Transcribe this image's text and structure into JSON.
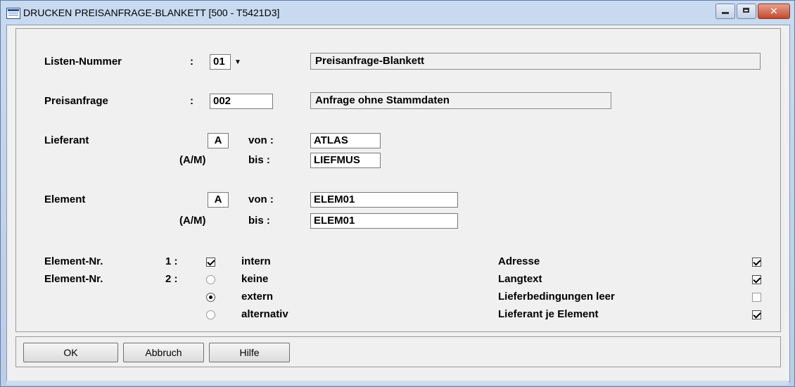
{
  "window": {
    "title": "DRUCKEN PREISANFRAGE-BLANKETT  [500 - T5421D3]"
  },
  "listen": {
    "label": "Listen-Nummer",
    "colon": ":",
    "value": "01",
    "description": "Preisanfrage-Blankett"
  },
  "preisanfrage": {
    "label": "Preisanfrage",
    "colon": ":",
    "value": "002",
    "description": "Anfrage ohne Stammdaten"
  },
  "lieferant": {
    "label": "Lieferant",
    "mode_hint": "(A/M)",
    "mode": "A",
    "von_label": "von :",
    "bis_label": "bis :",
    "von": "ATLAS",
    "bis": "LIEFMUS"
  },
  "element": {
    "label": "Element",
    "mode_hint": "(A/M)",
    "mode": "A",
    "von_label": "von :",
    "bis_label": "bis :",
    "von": "ELEM01",
    "bis": "ELEM01"
  },
  "elementnr1": {
    "label": "Element-Nr.",
    "number": "1 :",
    "option": "intern",
    "checked": true
  },
  "elementnr2": {
    "label": "Element-Nr.",
    "number": "2 :",
    "options": [
      {
        "label": "keine",
        "selected": false
      },
      {
        "label": "extern",
        "selected": true
      },
      {
        "label": "alternativ",
        "selected": false
      }
    ]
  },
  "right_options": [
    {
      "label": "Adresse",
      "checked": true
    },
    {
      "label": "Langtext",
      "checked": true
    },
    {
      "label": "Lieferbedingungen leer",
      "checked": false
    },
    {
      "label": "Lieferant je Element",
      "checked": true
    }
  ],
  "buttons": {
    "ok": "OK",
    "abbruch": "Abbruch",
    "hilfe": "Hilfe"
  },
  "icons": {
    "window": "form-window-icon",
    "minimize": "minimize-icon",
    "maximize": "maximize-icon",
    "close": "close-icon",
    "dropdown": "chevron-down-icon"
  }
}
